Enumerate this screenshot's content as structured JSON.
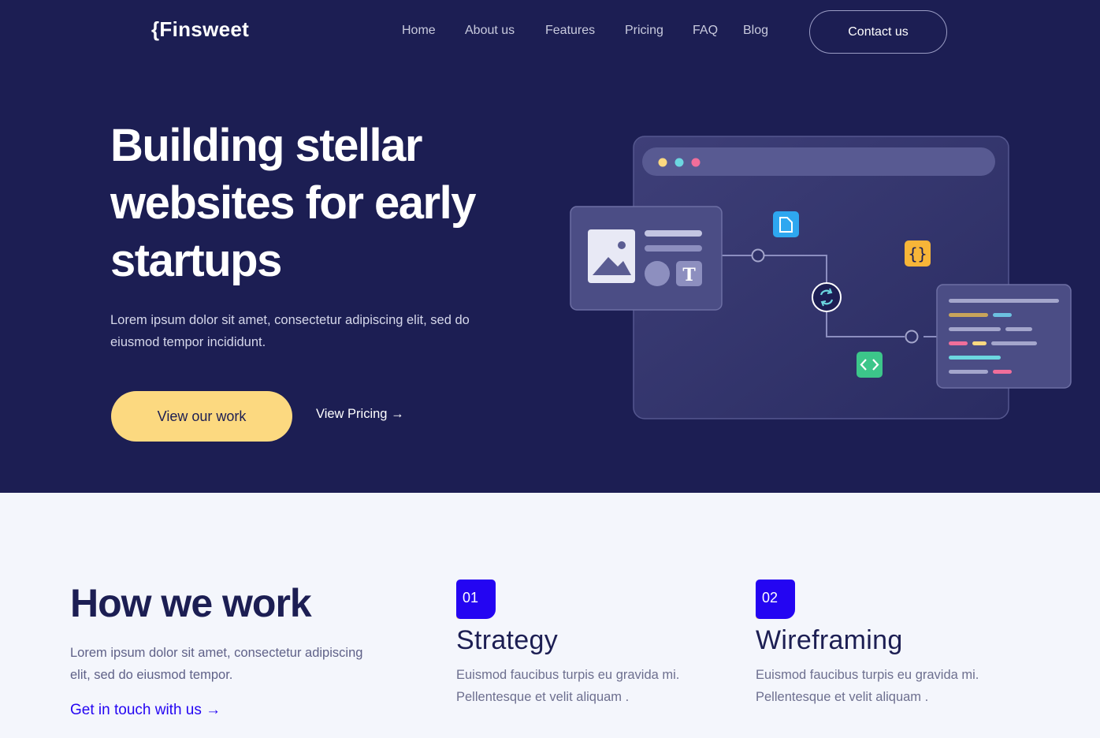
{
  "brand": {
    "logo": "{Finsweet"
  },
  "nav": {
    "items": [
      {
        "label": "Home"
      },
      {
        "label": "About us"
      },
      {
        "label": "Features"
      },
      {
        "label": "Pricing"
      },
      {
        "label": "FAQ"
      },
      {
        "label": "Blog"
      }
    ],
    "contact_label": "Contact us"
  },
  "hero": {
    "title": "Building stellar websites for early startups",
    "subtitle": "Lorem ipsum dolor sit amet, consectetur adipiscing elit, sed do eiusmod tempor incididunt.",
    "primary_cta": "View our work",
    "secondary_cta": "View Pricing →"
  },
  "how": {
    "title": "How we work",
    "subtitle": "Lorem ipsum dolor sit amet, consectetur adipiscing elit, sed do eiusmod tempor.",
    "link": "Get in touch with us →",
    "steps": [
      {
        "number": "01",
        "title": "Strategy",
        "text": "Euismod faucibus turpis eu gravida mi. Pellentesque et velit aliquam ."
      },
      {
        "number": "02",
        "title": "Wireframing",
        "text": "Euismod faucibus turpis eu gravida mi. Pellentesque et velit aliquam ."
      }
    ]
  },
  "illustration": {
    "icons": [
      "image-icon",
      "text-icon",
      "file-icon",
      "braces-icon",
      "sync-icon",
      "code-icon"
    ]
  },
  "colors": {
    "navy": "#1c1e53",
    "yellow": "#fcd980",
    "blue": "#2405f2",
    "light_bg": "#f4f6fc"
  }
}
